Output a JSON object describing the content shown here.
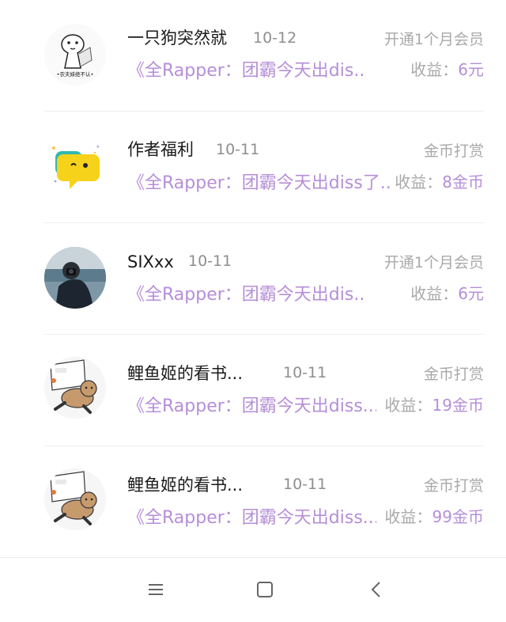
{
  "records": [
    {
      "name": "一只狗突然就",
      "date": "10-12",
      "type": "开通1个月会员",
      "book": "《全Rapper：团霸今天出dis...",
      "income_label": "收益：",
      "income_value": "6元",
      "avatar": "dog-meme-avatar",
      "avatar_caption": "•农夫妹绝不认•"
    },
    {
      "name": "作者福利",
      "date": "10-11",
      "type": "金币打赏",
      "book": "《全Rapper：团霸今天出diss了...",
      "income_label": "收益：",
      "income_value": "8金币",
      "avatar": "yellow-chat-bubble-avatar"
    },
    {
      "name": "SIXxx",
      "date": "10-11",
      "type": "开通1个月会员",
      "book": "《全Rapper：团霸今天出dis...",
      "income_label": "收益：",
      "income_value": "6元",
      "avatar": "photo-person-avatar"
    },
    {
      "name": "鲤鱼姬的看书...",
      "date": "10-11",
      "type": "金币打赏",
      "book": "《全Rapper：团霸今天出diss...",
      "income_label": "收益：",
      "income_value": "19金币",
      "avatar": "cartoon-bear-avatar"
    },
    {
      "name": "鲤鱼姬的看书...",
      "date": "10-11",
      "type": "金币打赏",
      "book": "《全Rapper：团霸今天出diss...",
      "income_label": "收益：",
      "income_value": "99金币",
      "avatar": "cartoon-bear-avatar"
    }
  ],
  "navbar": {
    "buttons": [
      "menu-icon",
      "home-square-icon",
      "back-chevron-icon"
    ]
  },
  "colors": {
    "accent_purple": "#b68ed8",
    "text_primary": "#1a1a1a",
    "text_secondary": "#a9a9a9",
    "divider": "#efefef"
  }
}
